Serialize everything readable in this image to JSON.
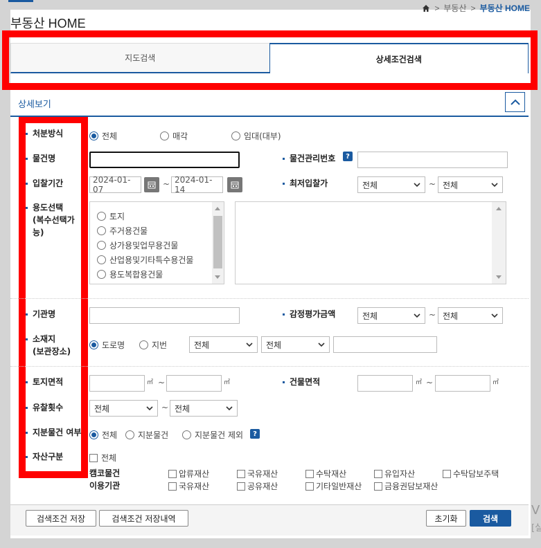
{
  "breadcrumb": {
    "item1": "부동산",
    "item2": "부동산 HOME"
  },
  "page_title": "부동산 HOME",
  "tabs": [
    {
      "label": "지도검색",
      "active": false
    },
    {
      "label": "상세조건검색",
      "active": true
    }
  ],
  "section": {
    "title": "상세보기"
  },
  "form": {
    "disposal": {
      "label": "처분방식",
      "options": [
        "전체",
        "매각",
        "임대(대부)"
      ],
      "selected": "전체"
    },
    "item_name": {
      "label": "물건명",
      "value": ""
    },
    "item_mgmt_no": {
      "label": "물건관리번호",
      "help": "?",
      "value": ""
    },
    "bid_period": {
      "label": "입찰기간",
      "start": "2024-01-07",
      "end": "2024-01-14",
      "tilde": "~"
    },
    "min_bid": {
      "label": "최저입찰가",
      "from": "전체",
      "to": "전체",
      "tilde": "~"
    },
    "usage": {
      "label_line1": "용도선택",
      "label_line2": "(복수선택가",
      "label_line3": "능)",
      "options": [
        "토지",
        "주거용건물",
        "상가용및업무용건물",
        "산업용및기타특수용건물",
        "용도복합용건물"
      ]
    },
    "agency": {
      "label": "기관명",
      "value": ""
    },
    "appraisal": {
      "label": "감정평가금액",
      "from": "전체",
      "to": "전체",
      "tilde": "~"
    },
    "location": {
      "label_line1": "소재지",
      "label_line2": "(보관장소)",
      "options": [
        "도로명",
        "지번"
      ],
      "selected": "도로명",
      "sel1": "전체",
      "sel2": "전체",
      "value": ""
    },
    "land_area": {
      "label": "토지면적",
      "unit": "㎡",
      "tilde": "~"
    },
    "building_area": {
      "label": "건물면적",
      "unit": "㎡",
      "tilde": "~"
    },
    "fail_count": {
      "label": "유찰횟수",
      "from": "전체",
      "to": "전체",
      "tilde": "~"
    },
    "share": {
      "label": "지분물건 여부",
      "options": [
        "전체",
        "지분물건",
        "지분물건 제외"
      ],
      "selected": "전체",
      "help": "?"
    },
    "asset": {
      "label": "자산구분",
      "all": "전체",
      "camco_label": "캠코물건",
      "camco_items": [
        "압류재산",
        "국유재산",
        "수탁재산",
        "유입자산",
        "수탁담보주택"
      ],
      "agency_label": "이용기관",
      "agency_items": [
        "국유재산",
        "공유재산",
        "기타일반재산",
        "금융권담보재산"
      ]
    }
  },
  "buttons": {
    "save_cond": "검색조건 저장",
    "save_history": "검색조건 저장내역",
    "reset": "초기화",
    "search": "검색"
  },
  "edge": {
    "char1": "V",
    "char2": "[실"
  },
  "colors": {
    "accent": "#1a5aa0",
    "highlight_box": "#ff0000"
  }
}
